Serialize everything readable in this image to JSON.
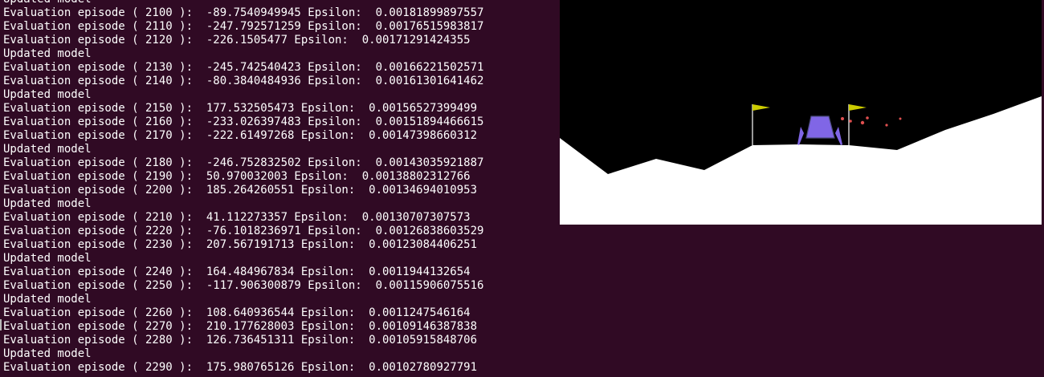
{
  "terminal": {
    "background": "#300a24",
    "text_color": "#ffffff",
    "lines": [
      "Updated model",
      "Evaluation episode ( 2100 ):  -89.7540949945 Epsilon:  0.00181899897557",
      "Evaluation episode ( 2110 ):  -247.792571259 Epsilon:  0.00176515983817",
      "Evaluation episode ( 2120 ):  -226.1505477 Epsilon:  0.00171291424355",
      "Updated model",
      "Evaluation episode ( 2130 ):  -245.742540423 Epsilon:  0.00166221502571",
      "Evaluation episode ( 2140 ):  -80.3840484936 Epsilon:  0.00161301641462",
      "Updated model",
      "Evaluation episode ( 2150 ):  177.532505473 Epsilon:  0.00156527399499",
      "Evaluation episode ( 2160 ):  -233.026397483 Epsilon:  0.00151894466615",
      "Evaluation episode ( 2170 ):  -222.61497268 Epsilon:  0.00147398660312",
      "Updated model",
      "Evaluation episode ( 2180 ):  -246.752832502 Epsilon:  0.00143035921887",
      "Evaluation episode ( 2190 ):  50.970032003 Epsilon:  0.00138802312766",
      "Evaluation episode ( 2200 ):  185.264260551 Epsilon:  0.00134694010953",
      "Updated model",
      "Evaluation episode ( 2210 ):  41.112273357 Epsilon:  0.00130707307573",
      "Evaluation episode ( 2220 ):  -76.1018236971 Epsilon:  0.00126838603529",
      "Evaluation episode ( 2230 ):  207.567191713 Epsilon:  0.00123084406251",
      "Updated model",
      "Evaluation episode ( 2240 ):  164.484967834 Epsilon:  0.0011944132654",
      "Evaluation episode ( 2250 ):  -117.906300879 Epsilon:  0.00115906075516",
      "Updated model",
      "Evaluation episode ( 2260 ):  108.640936544 Epsilon:  0.0011247546164",
      "Evaluation episode ( 2270 ):  210.177628003 Epsilon:  0.00109146387838",
      "Evaluation episode ( 2280 ):  126.736451311 Epsilon:  0.00105915848706",
      "Updated model",
      "Evaluation episode ( 2290 ):  175.980765126 Epsilon:  0.00102780927791"
    ]
  },
  "game": {
    "sky_color": "#000000",
    "terrain_color": "#ffffff",
    "flag_color": "#cccc00",
    "flagpole_color": "#ffffff",
    "lander_body_color": "#8066e6",
    "lander_outline_color": "#4d4d80",
    "lander_leg_color": "#8066e6",
    "particle_color": "#e05050"
  }
}
